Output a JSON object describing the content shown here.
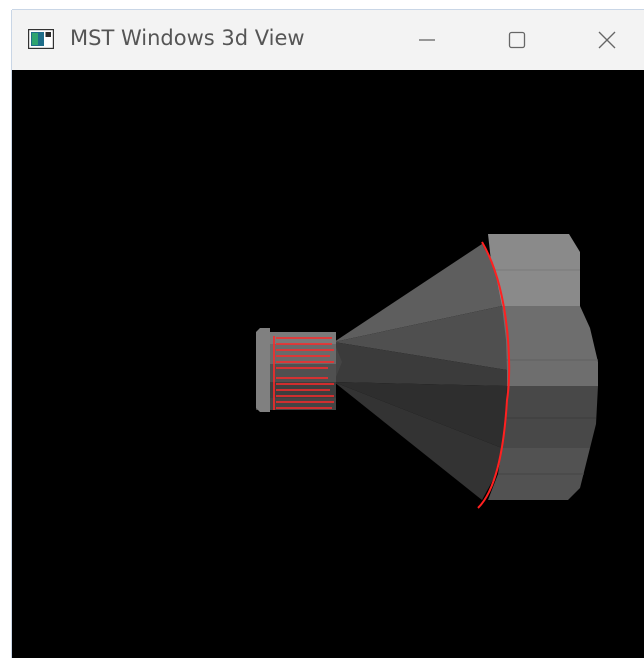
{
  "window": {
    "title": "MST Windows 3d View",
    "controls": {
      "minimize": "minimize-icon",
      "maximize": "maximize-icon",
      "close": "close-icon"
    }
  },
  "viewport": {
    "background": "#000000",
    "model_face_color": "#5a5a5a",
    "highlight_edge_color": "#ff2020"
  },
  "colors": {
    "titlebar": "#f3f3f3",
    "title_text": "#555555"
  }
}
